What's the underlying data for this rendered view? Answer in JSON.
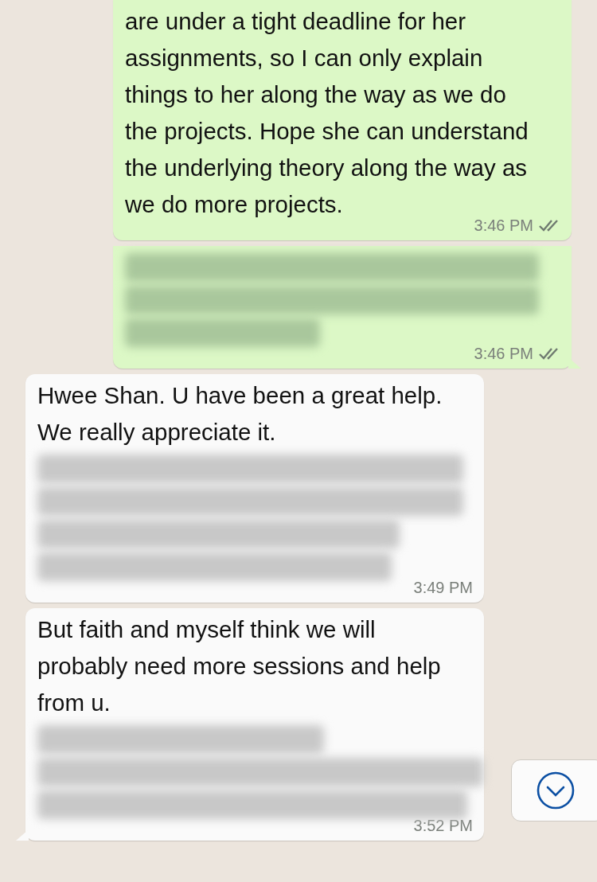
{
  "messages": [
    {
      "outgoing": true,
      "parts": [
        {
          "kind": "text",
          "text": "are under a tight deadline for her assignments, so I can only explain things to her along the way as we do the projects. Hope she can understand the underlying theory along the way as we do more projects."
        }
      ],
      "time": "3:46 PM",
      "read": true,
      "tail": false
    },
    {
      "outgoing": true,
      "parts": [
        {
          "kind": "redacted"
        },
        {
          "kind": "redacted"
        },
        {
          "kind": "redacted"
        }
      ],
      "time": "3:46 PM",
      "read": true,
      "tail": true
    },
    {
      "outgoing": false,
      "parts": [
        {
          "kind": "text",
          "text": "Hwee Shan. U have been a great help. We really appreciate it."
        },
        {
          "kind": "redacted"
        },
        {
          "kind": "redacted"
        },
        {
          "kind": "redacted"
        },
        {
          "kind": "redacted"
        }
      ],
      "time": "3:49 PM",
      "tail": false
    },
    {
      "outgoing": false,
      "parts": [
        {
          "kind": "text",
          "text": "But faith and myself think we will probably need more sessions and help from u."
        },
        {
          "kind": "redacted"
        },
        {
          "kind": "redacted"
        },
        {
          "kind": "redacted"
        }
      ],
      "time": "3:52 PM",
      "tail": true
    }
  ],
  "scroll_down_button": {
    "visible": true
  }
}
